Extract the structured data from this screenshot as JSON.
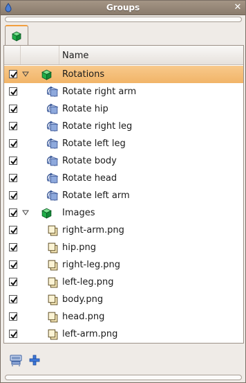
{
  "window": {
    "title": "Groups"
  },
  "table": {
    "column_name": "Name"
  },
  "rows": [
    {
      "label": "Rotations",
      "kind": "group",
      "checked": true,
      "expanded": true,
      "selected": true,
      "icon": "cube-icon"
    },
    {
      "label": "Rotate right arm",
      "kind": "child",
      "checked": true,
      "icon": "rotation-icon"
    },
    {
      "label": "Rotate hip",
      "kind": "child",
      "checked": true,
      "icon": "rotation-icon"
    },
    {
      "label": "Rotate right leg",
      "kind": "child",
      "checked": true,
      "icon": "rotation-icon"
    },
    {
      "label": "Rotate left leg",
      "kind": "child",
      "checked": true,
      "icon": "rotation-icon"
    },
    {
      "label": "Rotate body",
      "kind": "child",
      "checked": true,
      "icon": "rotation-icon"
    },
    {
      "label": "Rotate head",
      "kind": "child",
      "checked": true,
      "icon": "rotation-icon"
    },
    {
      "label": "Rotate left arm",
      "kind": "child",
      "checked": true,
      "icon": "rotation-icon"
    },
    {
      "label": "Images",
      "kind": "group",
      "checked": true,
      "expanded": true,
      "selected": false,
      "icon": "cube-icon"
    },
    {
      "label": "right-arm.png",
      "kind": "child",
      "checked": true,
      "icon": "image-file-icon"
    },
    {
      "label": "hip.png",
      "kind": "child",
      "checked": true,
      "icon": "image-file-icon"
    },
    {
      "label": "right-leg.png",
      "kind": "child",
      "checked": true,
      "icon": "image-file-icon"
    },
    {
      "label": "left-leg.png",
      "kind": "child",
      "checked": true,
      "icon": "image-file-icon"
    },
    {
      "label": "body.png",
      "kind": "child",
      "checked": true,
      "icon": "image-file-icon"
    },
    {
      "label": "head.png",
      "kind": "child",
      "checked": true,
      "icon": "image-file-icon"
    },
    {
      "label": "left-arm.png",
      "kind": "child",
      "checked": true,
      "icon": "image-file-icon"
    }
  ],
  "footer": {
    "buttons": [
      "remove-group-icon",
      "add-group-icon"
    ]
  },
  "colors": {
    "selection": "#f1b468",
    "tab_accent": "#f29f3f",
    "cube": "#1fae48"
  }
}
